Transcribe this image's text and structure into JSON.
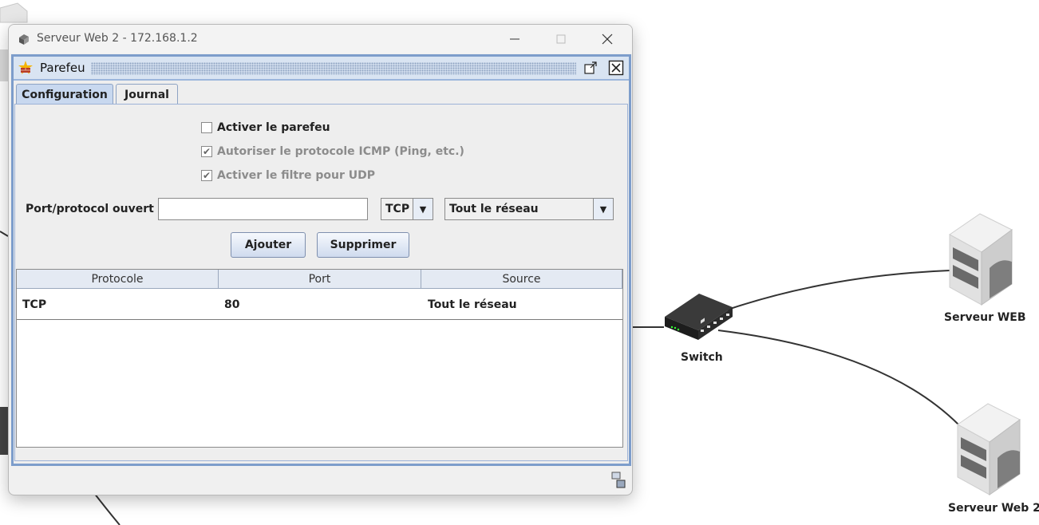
{
  "window": {
    "title": "Serveur Web 2 - 172.168.1.2"
  },
  "internal_frame": {
    "title": "Parefeu"
  },
  "tabs": [
    {
      "label": "Configuration",
      "selected": true
    },
    {
      "label": "Journal",
      "selected": false
    }
  ],
  "config": {
    "checkboxes": [
      {
        "label": "Activer le parefeu",
        "checked": false,
        "enabled": true
      },
      {
        "label": "Autoriser le protocole ICMP (Ping, etc.)",
        "checked": true,
        "enabled": false
      },
      {
        "label": "Activer le filtre pour UDP",
        "checked": true,
        "enabled": false
      }
    ],
    "port_label": "Port/protocol ouvert :",
    "port_value": "",
    "protocol_selected": "TCP",
    "source_selected": "Tout le réseau",
    "add_label": "Ajouter",
    "remove_label": "Supprimer"
  },
  "table": {
    "columns": [
      "Protocole",
      "Port",
      "Source"
    ],
    "rows": [
      {
        "protocol": "TCP",
        "port": "80",
        "source": "Tout le réseau"
      }
    ]
  },
  "network": {
    "nodes": {
      "switch": "Switch",
      "server_web": "Serveur WEB",
      "server_web2": "Serveur Web 2"
    }
  },
  "colors": {
    "frame_border": "#7d9dcb",
    "tab_selected": "#c8d8ef",
    "link_line": "#333333"
  }
}
